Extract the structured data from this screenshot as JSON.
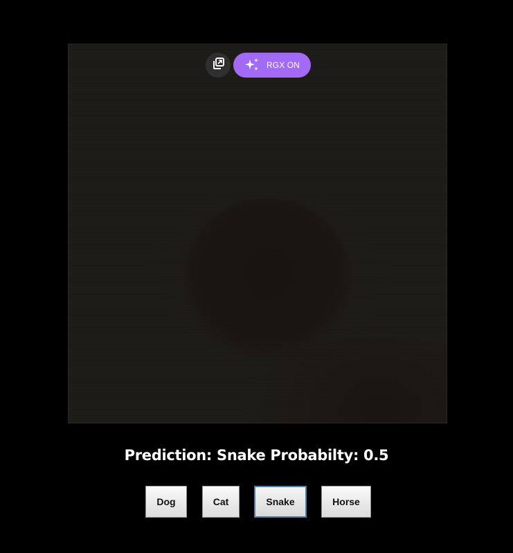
{
  "toolbar": {
    "copy_icon": "copy-icon",
    "rgx_icon": "sparkles-icon",
    "rgx_label": "RGX ON",
    "rgx_color": "#a26af5"
  },
  "prediction": {
    "text": "Prediction: Snake Probabilty: 0.5"
  },
  "classes": [
    {
      "label": "Dog",
      "selected": false
    },
    {
      "label": "Cat",
      "selected": false
    },
    {
      "label": "Snake",
      "selected": true
    },
    {
      "label": "Horse",
      "selected": false
    }
  ]
}
